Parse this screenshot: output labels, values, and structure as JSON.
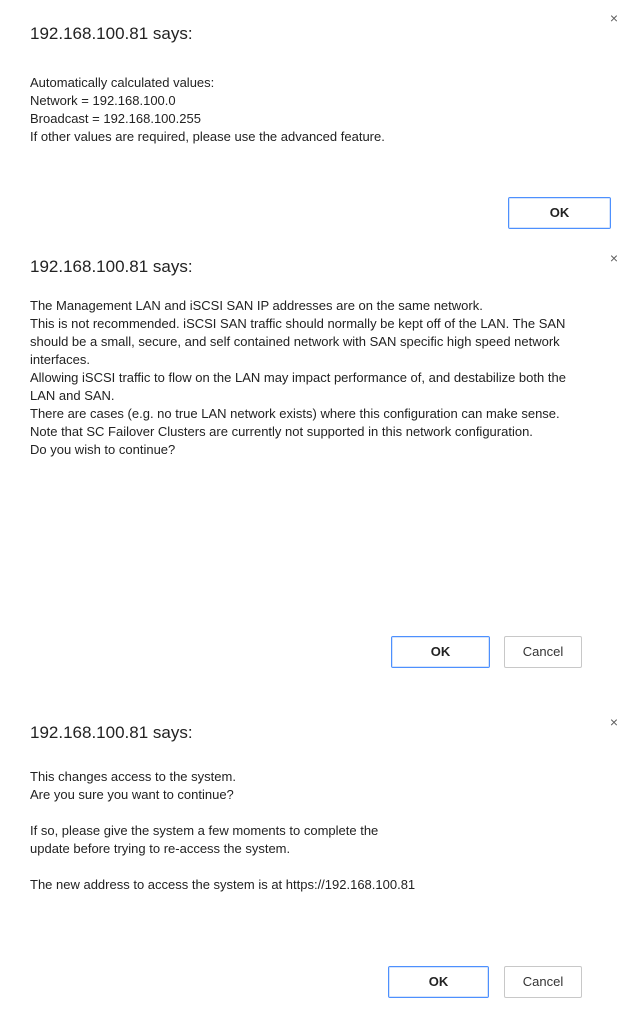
{
  "dialogs": [
    {
      "title": "192.168.100.81 says:",
      "close_glyph": "×",
      "lines": [
        "Automatically calculated values:",
        "Network = 192.168.100.0",
        "Broadcast = 192.168.100.255",
        "If other values are required, please use the advanced feature."
      ],
      "ok_label": "OK"
    },
    {
      "title": "192.168.100.81 says:",
      "close_glyph": "×",
      "lines": [
        "The Management LAN and iSCSI SAN IP addresses are on the same network.",
        "This is not recommended. iSCSI SAN traffic should normally be kept off of the LAN. The SAN should be a small, secure, and self contained network with SAN specific high speed network interfaces.",
        "Allowing iSCSI traffic to flow on the LAN may impact performance of, and destabilize both the LAN and SAN.",
        "There are cases (e.g. no true LAN network exists) where this configuration can make sense.",
        "Note that SC Failover Clusters are currently not supported in this network configuration.",
        "Do you wish to continue?"
      ],
      "ok_label": "OK",
      "cancel_label": "Cancel"
    },
    {
      "title": "192.168.100.81 says:",
      "close_glyph": "×",
      "lines": [
        "This changes access to the system.",
        "Are you sure you want to continue?",
        "",
        "If so, please give the system a few moments to complete the",
        "update before trying to re-access the system.",
        "",
        "The new address to access the system is at https://192.168.100.81"
      ],
      "ok_label": "OK",
      "cancel_label": "Cancel"
    }
  ],
  "colors": {
    "ok_border": "#4d90fe",
    "cancel_border": "#c8c8c8",
    "text": "#222222",
    "close_icon": "#5f5f5f"
  }
}
